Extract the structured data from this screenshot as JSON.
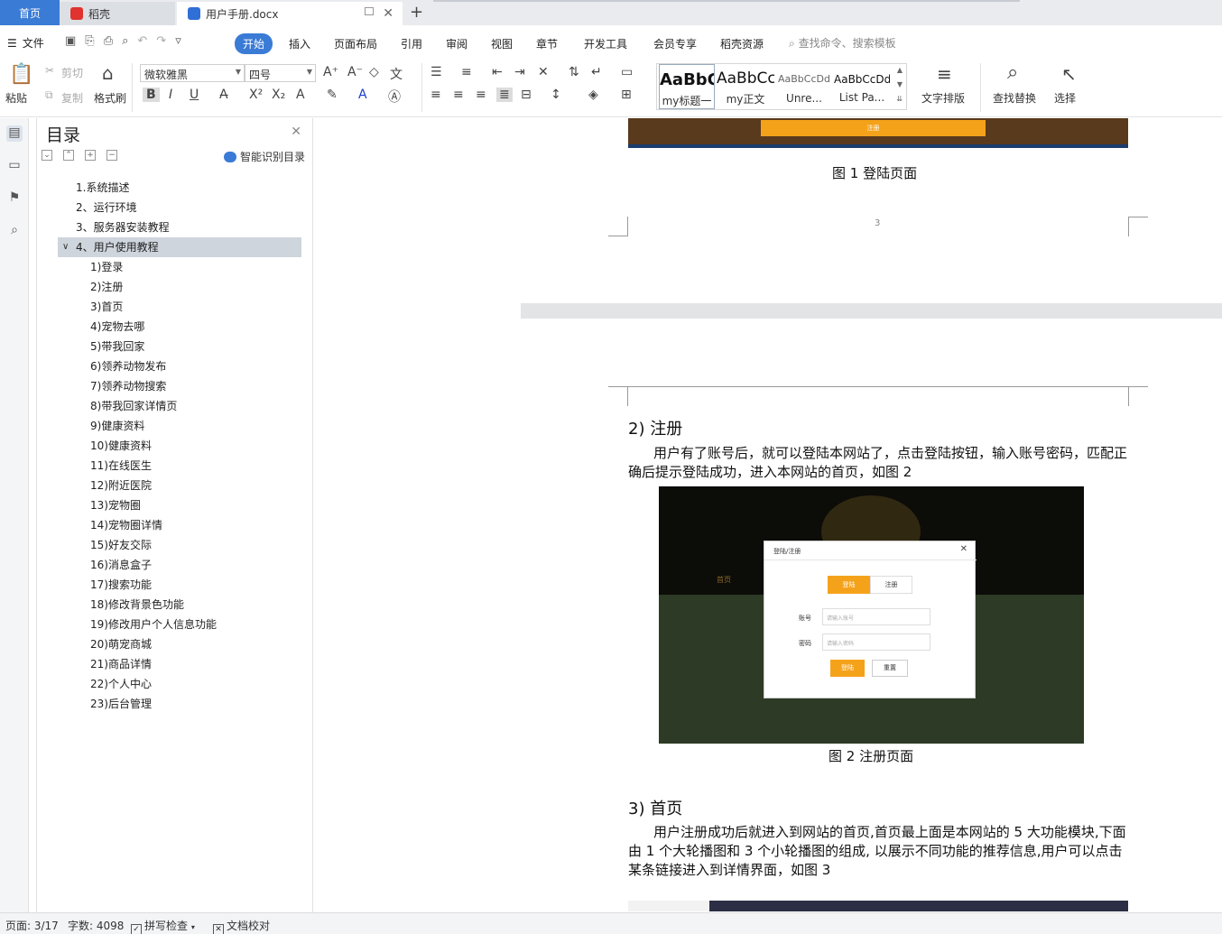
{
  "tabs": {
    "home": "首页",
    "straw": "稻壳",
    "doc": "用户手册.docx",
    "new_tab": "+"
  },
  "menu": {
    "file": "文件",
    "items": [
      "开始",
      "插入",
      "页面布局",
      "引用",
      "审阅",
      "视图",
      "章节",
      "开发工具",
      "会员专享",
      "稻壳资源"
    ],
    "search": "查找命令、搜索模板"
  },
  "ribbon": {
    "paste": "粘贴",
    "cut": "剪切",
    "copy": "复制",
    "format_painter": "格式刷",
    "font_name": "微软雅黑",
    "font_size": "四号",
    "styles": [
      {
        "preview": "AaBbC",
        "label": "my标题一"
      },
      {
        "preview": "AaBbCcl",
        "label": "my正文"
      },
      {
        "preview": "AaBbCcDd",
        "label": "Unre..."
      },
      {
        "preview": "AaBbCcDd",
        "label": "List Pa..."
      }
    ],
    "text_layout": "文字排版",
    "find_replace": "查找替换",
    "select": "选择"
  },
  "toc": {
    "title": "目录",
    "smart_label": "智能识别目录",
    "items": [
      {
        "label": "1.系统描述",
        "level": 1
      },
      {
        "label": "2、运行环境",
        "level": 1
      },
      {
        "label": "3、服务器安装教程",
        "level": 1
      },
      {
        "label": "4、用户使用教程",
        "level": 1,
        "selected": true
      },
      {
        "label": "1)登录",
        "level": 2
      },
      {
        "label": "2)注册",
        "level": 2
      },
      {
        "label": "3)首页",
        "level": 2
      },
      {
        "label": "4)宠物去哪",
        "level": 2
      },
      {
        "label": "5)带我回家",
        "level": 2
      },
      {
        "label": "6)领养动物发布",
        "level": 2
      },
      {
        "label": "7)领养动物搜索",
        "level": 2
      },
      {
        "label": "8)带我回家详情页",
        "level": 2
      },
      {
        "label": "9)健康资料",
        "level": 2
      },
      {
        "label": "10)健康资料",
        "level": 2
      },
      {
        "label": "11)在线医生",
        "level": 2
      },
      {
        "label": "12)附近医院",
        "level": 2
      },
      {
        "label": "13)宠物圈",
        "level": 2
      },
      {
        "label": "14)宠物圈详情",
        "level": 2
      },
      {
        "label": "15)好友交际",
        "level": 2
      },
      {
        "label": "16)消息盒子",
        "level": 2
      },
      {
        "label": "17)搜索功能",
        "level": 2
      },
      {
        "label": "18)修改背景色功能",
        "level": 2
      },
      {
        "label": "19)修改用户个人信息功能",
        "level": 2
      },
      {
        "label": "20)萌宠商城",
        "level": 2
      },
      {
        "label": "21)商品详情",
        "level": 2
      },
      {
        "label": "22)个人中心",
        "level": 2
      },
      {
        "label": "23)后台管理",
        "level": 2
      }
    ]
  },
  "document": {
    "fig1_button": "注册",
    "fig1_caption": "图 1  登陆页面",
    "page_number": "3",
    "sec2_heading": "2)  注册",
    "sec2_para": "用户有了账号后，就可以登陆本网站了，点击登陆按钮，输入账号密码，匹配正确后提示登陆成功，进入本网站的首页，如图 2",
    "fig2": {
      "dialog_title": "登陆/注册",
      "tab_login": "登陆",
      "tab_register": "注册",
      "account_label": "账号",
      "account_placeholder": "请输入账号",
      "password_label": "密码",
      "password_placeholder": "请输入密码",
      "login_button": "登陆",
      "reset_button": "重置",
      "nav_home": "首页"
    },
    "fig2_caption": "图 2  注册页面",
    "sec3_heading": "3)  首页",
    "sec3_para": "用户注册成功后就进入到网站的首页,首页最上面是本网站的 5 大功能模块,下面由 1 个大轮播图和 3 个小轮播图的组成, 以展示不同功能的推荐信息,用户可以点击某条链接进入到详情界面，如图 3"
  },
  "status": {
    "page": "页面: 3/17",
    "words": "字数: 4098",
    "spell_check": "拼写检查",
    "doc_proof": "文档校对"
  },
  "colors": {
    "accent": "#3a7bd5",
    "orange": "#f5a21b"
  }
}
